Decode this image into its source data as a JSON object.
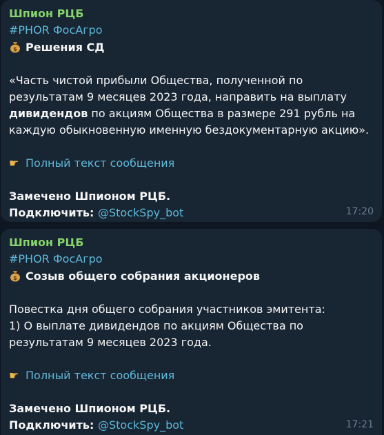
{
  "messages": [
    {
      "sender": "Шпион РЦБ",
      "hashtag": "#PHOR ФосАгро",
      "emoji_icon": "money-bag-icon",
      "heading": "Решения СД",
      "body_before_bold": "«Часть чистой прибыли Общества, полученной по результатам 9 месяцев 2023 года, направить на выплату ",
      "body_bold": "дивидендов",
      "body_after_bold": " по акциям Общества в размере 291 рубль на каждую обыкновенную именную бездокументарную акцию».",
      "pointer_icon": "pointing-hand-icon",
      "full_text_link": "Полный текст сообщения",
      "noticed_label": "Замечено  Шпионом РЦБ.",
      "subscribe_label": "Подключить:",
      "bot_link": "@StockSpy_bot",
      "time": "17:20"
    },
    {
      "sender": "Шпион РЦБ",
      "hashtag": "#PHOR ФосАгро",
      "emoji_icon": "money-bag-icon",
      "heading": "Созыв общего собрания акционеров",
      "body_line1": "Повестка дня общего собрания участников эмитента:",
      "body_line2": "1) О выплате дивидендов по акциям Общества по результатам 9 месяцев 2023 года.",
      "pointer_icon": "pointing-hand-icon",
      "full_text_link": "Полный текст сообщения",
      "noticed_label": "Замечено  Шпионом РЦБ.",
      "subscribe_label": "Подключить:",
      "bot_link": "@StockSpy_bot",
      "time": "17:21"
    }
  ],
  "colors": {
    "background": "#0e1621",
    "bubble": "#182533",
    "sender": "#86d36a",
    "link": "#5fb9d9",
    "time": "#6d7f8f"
  }
}
